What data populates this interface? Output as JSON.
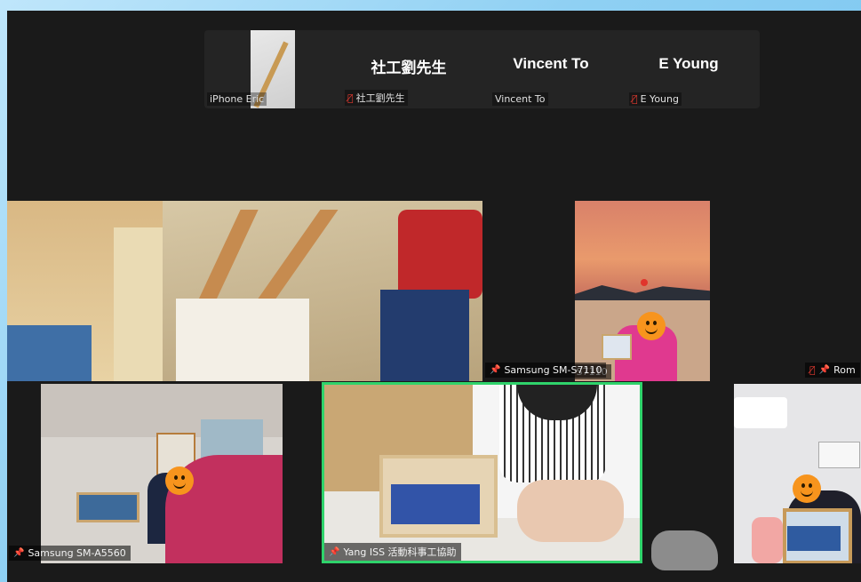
{
  "top_strip": {
    "tiles": [
      {
        "display_name": "",
        "label": "iPhone Eric",
        "muted": false
      },
      {
        "display_name": "社工劉先生",
        "label": "社工劉先生",
        "muted": true
      },
      {
        "display_name": "Vincent To",
        "label": "Vincent To",
        "muted": false
      },
      {
        "display_name": "E Young",
        "label": "E Young",
        "muted": true
      }
    ]
  },
  "grid": {
    "row1": [
      {
        "label": "",
        "pinned": false,
        "muted": false
      },
      {
        "label": "Samsung SM-S7110",
        "pinned": true,
        "muted": false
      },
      {
        "label": "Rom",
        "pinned": true,
        "muted": true
      }
    ],
    "row2": [
      {
        "label": "Samsung SM-A5560",
        "pinned": true,
        "muted": false
      },
      {
        "label": "Yang ISS 活動科事工協助",
        "pinned": true,
        "muted": false,
        "active_speaker": true
      },
      {
        "label": "",
        "pinned": false,
        "muted": false
      }
    ]
  },
  "colors": {
    "active_border": "#2fd36b",
    "mute_red": "#e0392f",
    "desktop_blue": "#8fd0f3"
  },
  "icons": [
    "microphone-muted-icon",
    "pin-icon",
    "emoji-face-icon"
  ]
}
